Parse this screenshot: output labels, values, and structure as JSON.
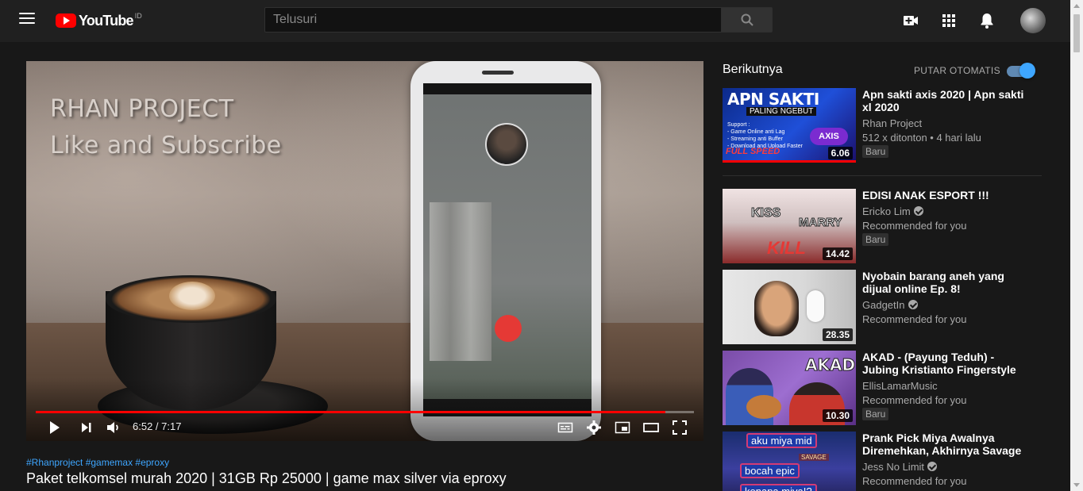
{
  "header": {
    "logo_text": "YouTube",
    "logo_country": "ID",
    "search_placeholder": "Telusuri",
    "icons": [
      "menu-icon",
      "search-icon",
      "create-video-icon",
      "apps-icon",
      "notifications-icon"
    ]
  },
  "player": {
    "overlay_line1": "RHAN PROJECT",
    "overlay_line2": "Like and Subscribe",
    "time_display": "6:52 / 7:17",
    "progress": 0.957,
    "accent": "#ff0000"
  },
  "video": {
    "hashtags": "#Rhanproject #gamemax #eproxy",
    "title": "Paket telkomsel murah 2020 | 31GB Rp 25000 | game max silver via eproxy"
  },
  "sidebar": {
    "up_next_label": "Berikutnya",
    "autoplay_label": "PUTAR OTOMATIS",
    "autoplay_on": true,
    "items": [
      {
        "title": "Apn sakti axis 2020 | Apn sakti xl 2020",
        "channel": "Rhan Project",
        "meta": "512 x ditonton • 4 hari lalu",
        "badge": "Baru",
        "duration": "6.06",
        "verified": false,
        "thumb_text": "APN SAKTI",
        "thumb_sub": "PALING NGEBUT",
        "thumb_list": "Support :\n- Game Online anti Lag\n- Streaming anti Buffer\n- Download and Upload Faster",
        "thumb_axis": "AXIS",
        "thumb_speed": "FULL SPEED"
      },
      {
        "title": "EDISI ANAK ESPORT !!!",
        "channel": "Ericko Lim",
        "meta": "Recommended for you",
        "badge": "Baru",
        "duration": "14.42",
        "verified": true,
        "thumb_l1": "KISS",
        "thumb_l2": "MARRY",
        "thumb_l3": "KILL"
      },
      {
        "title": "Nyobain barang aneh yang dijual online Ep. 8!",
        "channel": "GadgetIn",
        "meta": "Recommended for you",
        "duration": "28.35",
        "verified": true
      },
      {
        "title": "AKAD - (Payung Teduh) - Jubing Kristianto Fingerstyle Guitar...",
        "channel": "EllisLamarMusic",
        "meta": "Recommended for you",
        "badge": "Baru",
        "duration": "10.30",
        "verified": false,
        "thumb_text": "AKAD"
      },
      {
        "title": "Prank Pick Miya Awalnya Diremehkan, Akhirnya Savage ...",
        "channel": "Jess No Limit",
        "meta": "Recommended for you",
        "verified": true,
        "thumb_cap1": "aku miya mid",
        "thumb_cap2": "bocah epic",
        "thumb_cap3": "kenapa miya!?",
        "thumb_savage": "SAVAGE"
      }
    ]
  }
}
